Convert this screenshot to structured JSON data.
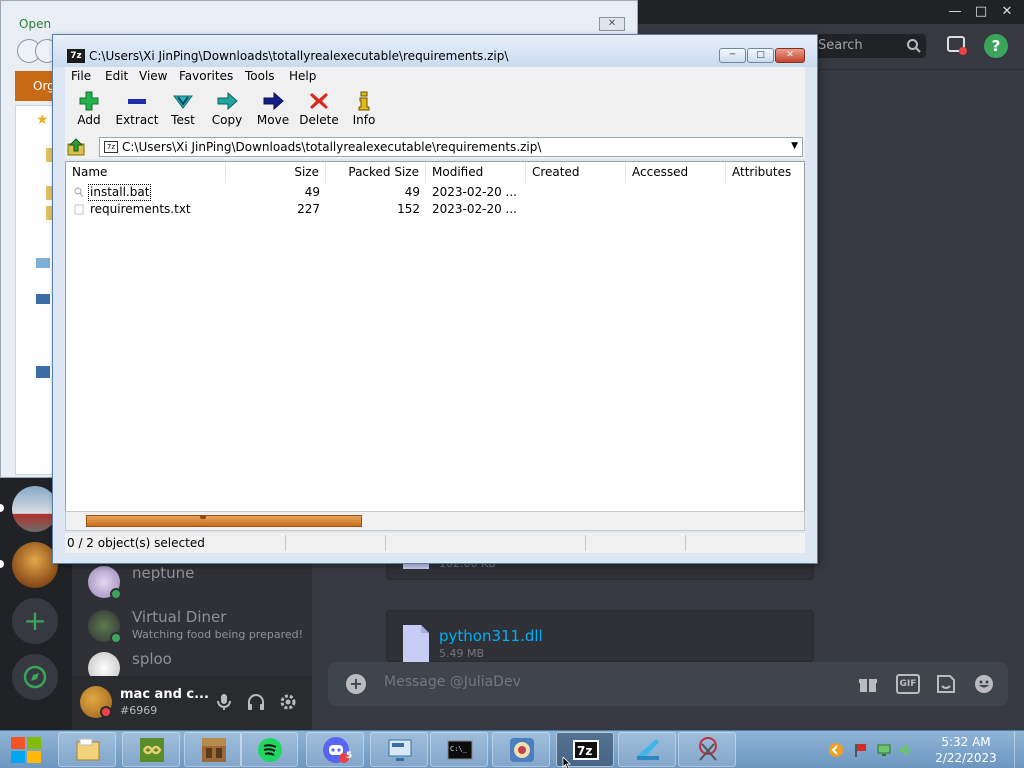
{
  "open_dialog": {
    "title": "Open",
    "org_button": "Organize"
  },
  "discord": {
    "search_placeholder": "Search",
    "dms": [
      {
        "name": "neptune",
        "subtitle": ""
      },
      {
        "name": "Virtual Diner",
        "subtitle": "Watching food being prepared!"
      },
      {
        "name": "sploo",
        "subtitle": ""
      }
    ],
    "user": {
      "name": "mac and c...",
      "tag": "#6969"
    },
    "attachments": [
      {
        "name": "",
        "size": "102.00 KB"
      },
      {
        "name": "python311.dll",
        "size": "5.49 MB"
      }
    ],
    "message_placeholder": "Message @JuliaDev",
    "gif_label": "GIF",
    "discord_badge": "5",
    "colors": {
      "bg": "#36393f",
      "link": "#00aff4",
      "online": "#3ba55c"
    }
  },
  "sevenzip": {
    "title": "C:\\Users\\Xi JinPing\\Downloads\\totallyrealexecutable\\requirements.zip\\",
    "app_icon_label": "7z",
    "menu": [
      "File",
      "Edit",
      "View",
      "Favorites",
      "Tools",
      "Help"
    ],
    "toolbar": [
      {
        "label": "Add",
        "icon": "add-icon"
      },
      {
        "label": "Extract",
        "icon": "extract-icon"
      },
      {
        "label": "Test",
        "icon": "test-icon"
      },
      {
        "label": "Copy",
        "icon": "copy-icon"
      },
      {
        "label": "Move",
        "icon": "move-icon"
      },
      {
        "label": "Delete",
        "icon": "delete-icon"
      },
      {
        "label": "Info",
        "icon": "info-icon"
      }
    ],
    "address": "C:\\Users\\Xi JinPing\\Downloads\\totallyrealexecutable\\requirements.zip\\",
    "columns": [
      "Name",
      "Size",
      "Packed Size",
      "Modified",
      "Created",
      "Accessed",
      "Attributes"
    ],
    "files": [
      {
        "name": "install.bat",
        "size": "49",
        "packed": "49",
        "modified": "2023-02-20 ..."
      },
      {
        "name": "requirements.txt",
        "size": "227",
        "packed": "152",
        "modified": "2023-02-20 ..."
      }
    ],
    "status": "0 / 2 object(s) selected"
  },
  "taskbar": {
    "apps": [
      "file-explorer",
      "minecraft-launcher",
      "minecraft",
      "spotify",
      "discord",
      "remote-desktop",
      "command-prompt",
      "game",
      "7-zip",
      "pycharm",
      "snipping-tool"
    ],
    "active_app": "7-zip",
    "time": "5:32 AM",
    "date": "2/22/2023",
    "cmd_label": "C:\\_"
  }
}
